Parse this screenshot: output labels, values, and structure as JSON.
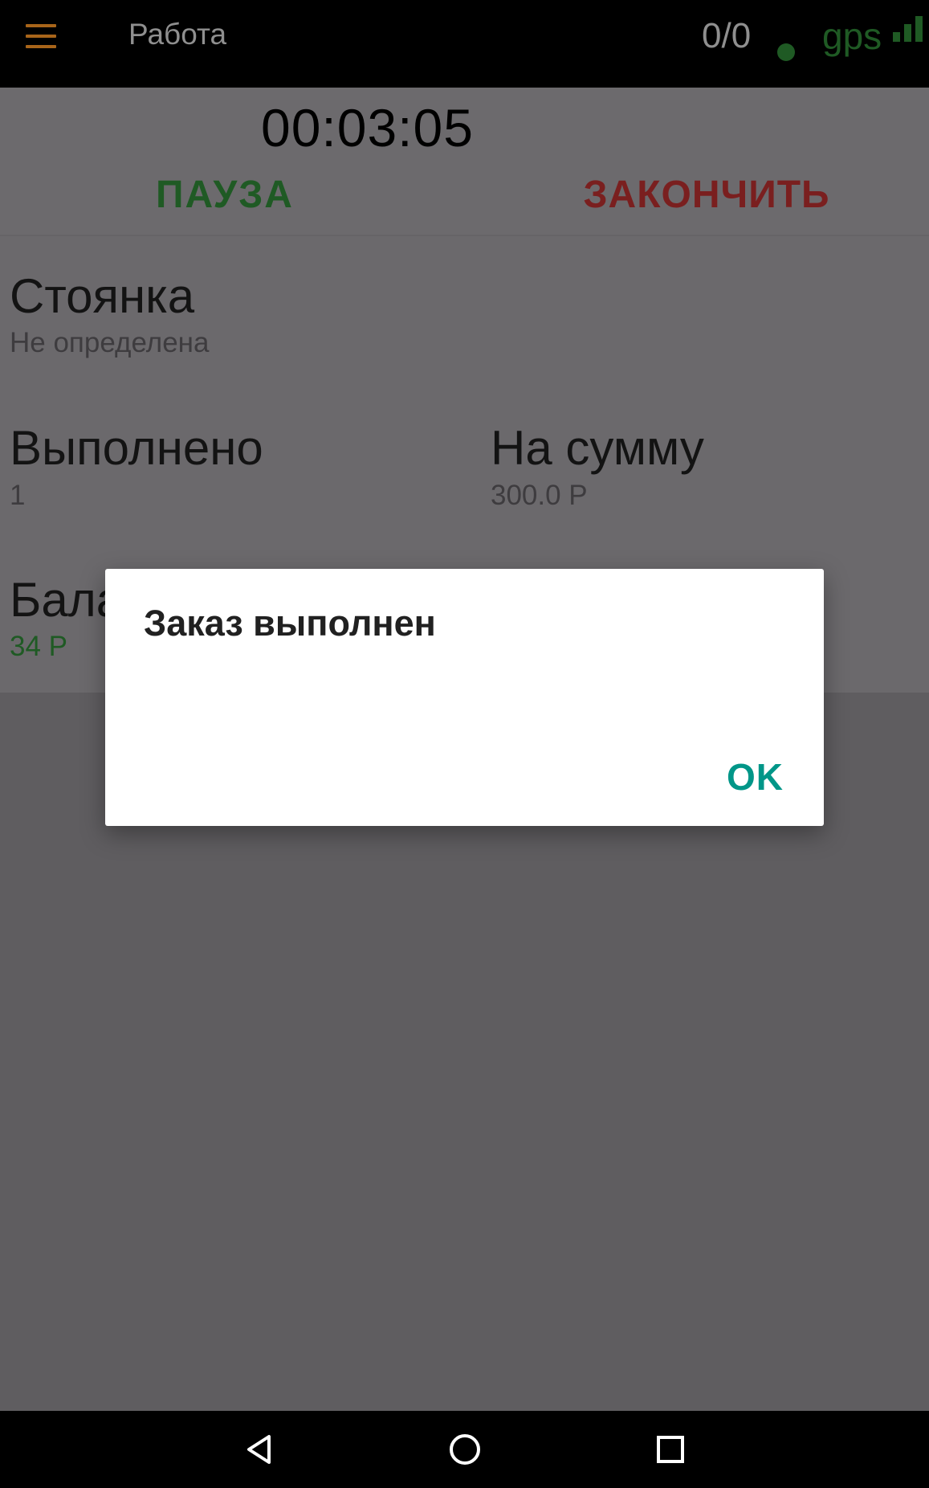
{
  "topbar": {
    "menu_icon": "hamburger-menu-icon",
    "title": "Работа",
    "counter": "0/0",
    "gps_label": "gps",
    "gps_color": "#1f5a24",
    "menu_color": "#a8651a"
  },
  "timer": {
    "time": "00:03:05",
    "pause_label": "ПАУЗА",
    "finish_label": "ЗАКОНЧИТЬ"
  },
  "fields": {
    "parking": {
      "label": "Стоянка",
      "value": "Не определена"
    },
    "completed": {
      "label": "Выполнено",
      "value": "1"
    },
    "amount": {
      "label": "На сумму",
      "value": "300.0 Р"
    },
    "balance": {
      "label": "Бала",
      "value": "34 Р"
    }
  },
  "dialog": {
    "title": "Заказ выполнен",
    "ok_label": "OK",
    "accent": "#009688"
  },
  "navbar": {
    "back_icon": "back-triangle-icon",
    "home_icon": "home-circle-icon",
    "recents_icon": "recents-square-icon"
  }
}
